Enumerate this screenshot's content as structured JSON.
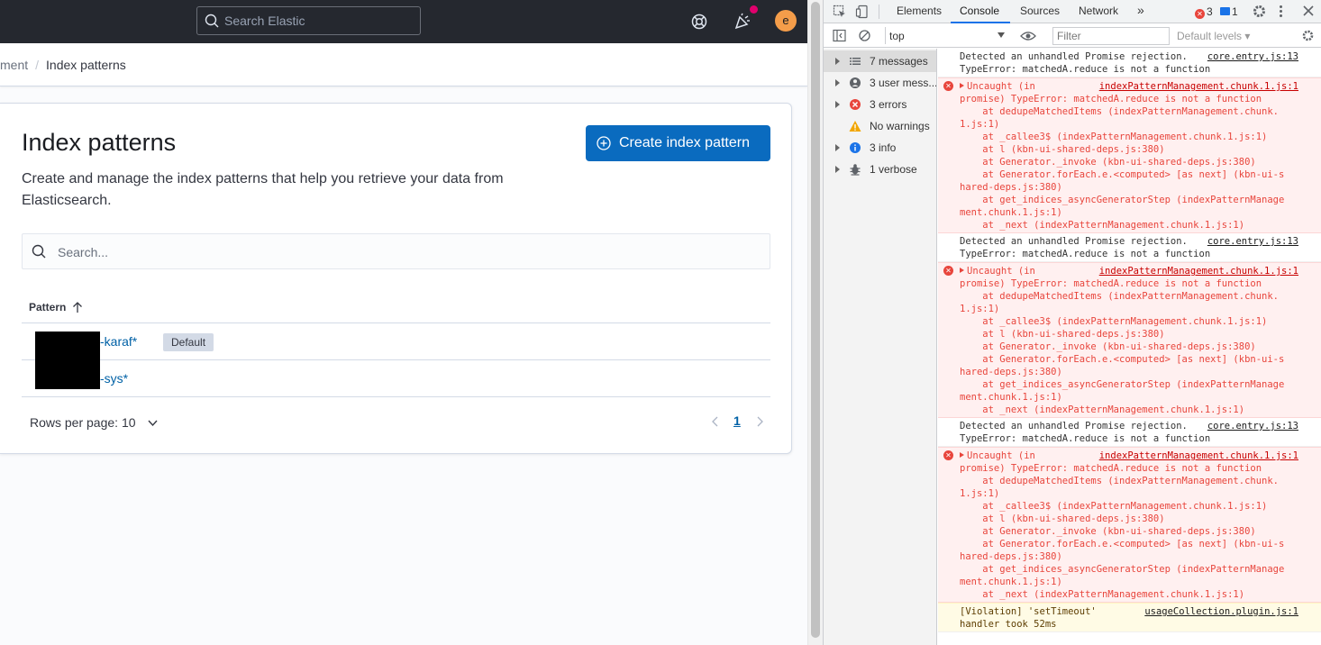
{
  "app": {
    "search_placeholder": "Search Elastic",
    "avatar_letter": "e",
    "breadcrumb": [
      "ment",
      "Index patterns"
    ],
    "breadcrumb_separator": "/",
    "title": "Index patterns",
    "description": "Create and manage the index patterns that help you retrieve your data from Elasticsearch.",
    "create_button": "Create index pattern",
    "table_search_placeholder": "Search...",
    "column_pattern": "Pattern",
    "rows": [
      {
        "pattern": "-karaf*",
        "badge": "Default"
      },
      {
        "pattern": "-sys*",
        "badge": ""
      }
    ],
    "rows_per_page": "Rows per page: 10",
    "current_page": "1",
    "colors": {
      "topbar": "#25282f",
      "accent": "#0a6bbf",
      "avatar": "#f49d4a"
    }
  },
  "devtools": {
    "tabs": [
      "Elements",
      "Console",
      "Sources",
      "Network",
      "»"
    ],
    "error_count": "3",
    "message_count": "1",
    "context": "top",
    "filter_placeholder": "Filter",
    "levels": "Default levels ▾",
    "sidebar": [
      {
        "label": "7 messages",
        "icon": "list-icon"
      },
      {
        "label": "3 user mess...",
        "icon": "user-icon"
      },
      {
        "label": "3 errors",
        "icon": "error-icon"
      },
      {
        "label": "No warnings",
        "icon": "warning-icon"
      },
      {
        "label": "3 info",
        "icon": "info-icon"
      },
      {
        "label": "1 verbose",
        "icon": "bug-icon"
      }
    ],
    "messages": [
      {
        "type": "plain",
        "lines": [
          "Detected an unhandled Promise rejection.",
          "TypeError: matchedA.reduce is not a function"
        ],
        "source": "core.entry.js:13"
      },
      {
        "type": "error",
        "lines": [
          "Uncaught (in",
          "promise) TypeError: matchedA.reduce is not a function",
          "    at dedupeMatchedItems (indexPatternManagement.chunk.",
          "1.js:1)",
          "    at _callee3$ (indexPatternManagement.chunk.1.js:1)",
          "    at l (kbn-ui-shared-deps.js:380)",
          "    at Generator._invoke (kbn-ui-shared-deps.js:380)",
          "    at Generator.forEach.e.<computed> [as next] (kbn-ui-s",
          "hared-deps.js:380)",
          "    at get_indices_asyncGeneratorStep (indexPatternManage",
          "ment.chunk.1.js:1)",
          "    at _next (indexPatternManagement.chunk.1.js:1)"
        ],
        "source": "indexPatternManagement.chunk.1.js:1"
      },
      {
        "type": "plain",
        "lines": [
          "Detected an unhandled Promise rejection.",
          "TypeError: matchedA.reduce is not a function"
        ],
        "source": "core.entry.js:13"
      },
      {
        "type": "error",
        "lines": [
          "Uncaught (in",
          "promise) TypeError: matchedA.reduce is not a function",
          "    at dedupeMatchedItems (indexPatternManagement.chunk.",
          "1.js:1)",
          "    at _callee3$ (indexPatternManagement.chunk.1.js:1)",
          "    at l (kbn-ui-shared-deps.js:380)",
          "    at Generator._invoke (kbn-ui-shared-deps.js:380)",
          "    at Generator.forEach.e.<computed> [as next] (kbn-ui-s",
          "hared-deps.js:380)",
          "    at get_indices_asyncGeneratorStep (indexPatternManage",
          "ment.chunk.1.js:1)",
          "    at _next (indexPatternManagement.chunk.1.js:1)"
        ],
        "source": "indexPatternManagement.chunk.1.js:1"
      },
      {
        "type": "plain",
        "lines": [
          "Detected an unhandled Promise rejection.",
          "TypeError: matchedA.reduce is not a function"
        ],
        "source": "core.entry.js:13"
      },
      {
        "type": "error",
        "lines": [
          "Uncaught (in",
          "promise) TypeError: matchedA.reduce is not a function",
          "    at dedupeMatchedItems (indexPatternManagement.chunk.",
          "1.js:1)",
          "    at _callee3$ (indexPatternManagement.chunk.1.js:1)",
          "    at l (kbn-ui-shared-deps.js:380)",
          "    at Generator._invoke (kbn-ui-shared-deps.js:380)",
          "    at Generator.forEach.e.<computed> [as next] (kbn-ui-s",
          "hared-deps.js:380)",
          "    at get_indices_asyncGeneratorStep (indexPatternManage",
          "ment.chunk.1.js:1)",
          "    at _next (indexPatternManagement.chunk.1.js:1)"
        ],
        "source": "indexPatternManagement.chunk.1.js:1"
      },
      {
        "type": "violation",
        "lines": [
          "[Violation] 'setTimeout'",
          "handler took 52ms"
        ],
        "source": "usageCollection.plugin.js:1"
      }
    ]
  }
}
